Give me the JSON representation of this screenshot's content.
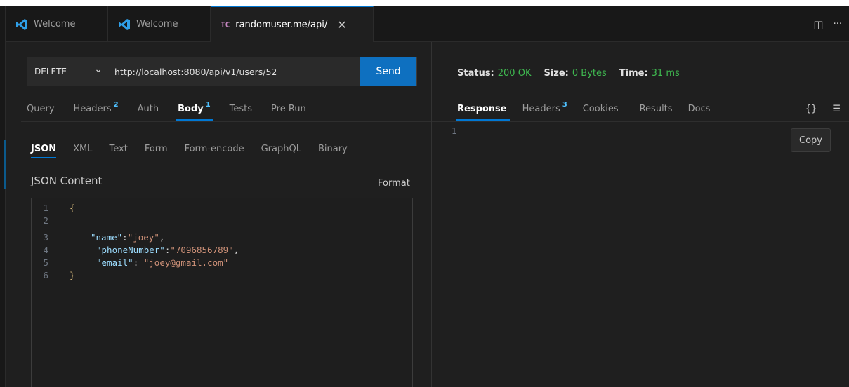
{
  "tabs": [
    {
      "label": "Welcome",
      "icon": "vscode-icon"
    },
    {
      "label": "Welcome",
      "icon": "vscode-icon"
    },
    {
      "label": "randomuser.me/api/",
      "icon_text": "TC",
      "close": "✕"
    }
  ],
  "tabbar_actions": {
    "split": "◫",
    "more": "···"
  },
  "request": {
    "method": "DELETE",
    "method_chevron": "⌄",
    "url": "http://localhost:8080/api/v1/users/52",
    "send_label": "Send"
  },
  "request_tabs": [
    {
      "label": "Query"
    },
    {
      "label": "Headers",
      "badge": "2"
    },
    {
      "label": "Auth"
    },
    {
      "label": "Body",
      "badge": "1"
    },
    {
      "label": "Tests"
    },
    {
      "label": "Pre Run"
    }
  ],
  "body_types": [
    "JSON",
    "XML",
    "Text",
    "Form",
    "Form-encode",
    "GraphQL",
    "Binary"
  ],
  "json_content_label": "JSON Content",
  "format_label": "Format",
  "editor_lines": [
    {
      "n": "1",
      "text": "{"
    },
    {
      "n": "2",
      "text": ""
    },
    {
      "n": "3",
      "key": "\"name\"",
      "sep": ":",
      "value": "\"joey\"",
      "tail": ","
    },
    {
      "n": "4",
      "key": "\"phoneNumber\"",
      "sep": ":",
      "value": "\"7096856789\"",
      "tail": ","
    },
    {
      "n": "5",
      "key": "\"email\"",
      "sep": ": ",
      "value": "\"joey@gmail.com\"",
      "tail": ""
    },
    {
      "n": "6",
      "text": "}"
    }
  ],
  "status": {
    "status_label": "Status:",
    "status_value": "200 OK",
    "size_label": "Size:",
    "size_value": "0 Bytes",
    "time_label": "Time:",
    "time_value": "31 ms"
  },
  "response_tabs": [
    {
      "label": "Response"
    },
    {
      "label": "Headers",
      "badge": "3"
    },
    {
      "label": "Cookies"
    },
    {
      "label": "Results"
    },
    {
      "label": "Docs"
    }
  ],
  "response_icons": {
    "braces": "{}",
    "wrap": "☰"
  },
  "response_line": "1",
  "copy_label": "Copy",
  "colors": {
    "accent": "#0078d4",
    "send": "#0e70c0",
    "status_ok": "#3fb950",
    "badge": "#4fc1ff"
  }
}
